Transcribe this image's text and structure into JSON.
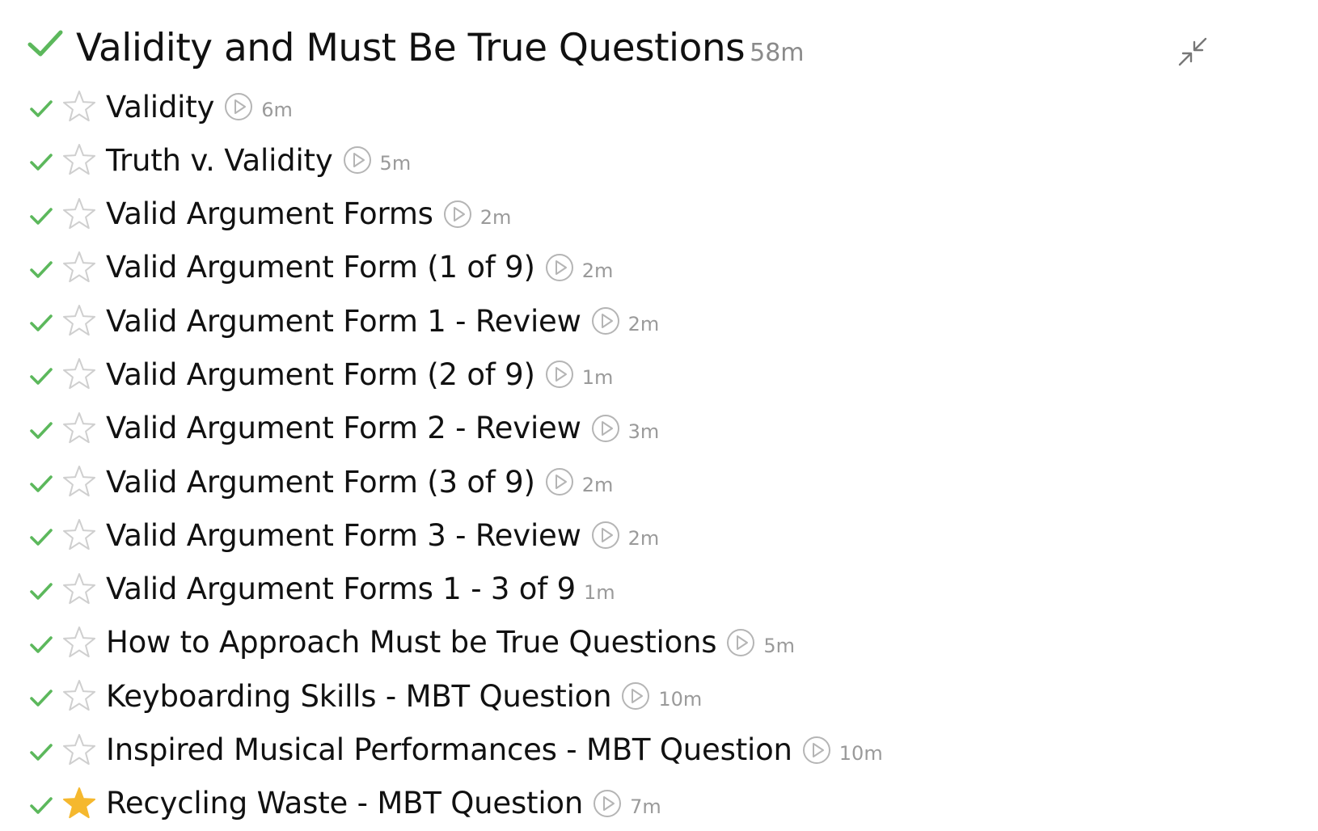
{
  "section": {
    "title": "Validity and Must Be True Questions",
    "duration": "58m",
    "completed": true,
    "icons": {
      "complete": "checkmark-icon",
      "collapse": "collapse-arrows-icon"
    },
    "colors": {
      "check": "#5cb85c",
      "star_filled": "#f5b82e",
      "star_outline": "#cfcfcf",
      "play_outline": "#b5b5b5",
      "muted_text": "#9a9a9a"
    }
  },
  "lessons": [
    {
      "title": "Validity",
      "duration": "6m",
      "has_video": true,
      "starred": false,
      "completed": true
    },
    {
      "title": "Truth v. Validity",
      "duration": "5m",
      "has_video": true,
      "starred": false,
      "completed": true
    },
    {
      "title": "Valid Argument Forms",
      "duration": "2m",
      "has_video": true,
      "starred": false,
      "completed": true
    },
    {
      "title": "Valid Argument Form (1 of 9)",
      "duration": "2m",
      "has_video": true,
      "starred": false,
      "completed": true
    },
    {
      "title": "Valid Argument Form 1 - Review",
      "duration": "2m",
      "has_video": true,
      "starred": false,
      "completed": true
    },
    {
      "title": "Valid Argument Form (2 of 9)",
      "duration": "1m",
      "has_video": true,
      "starred": false,
      "completed": true
    },
    {
      "title": "Valid Argument Form 2 - Review",
      "duration": "3m",
      "has_video": true,
      "starred": false,
      "completed": true
    },
    {
      "title": "Valid Argument Form (3 of 9)",
      "duration": "2m",
      "has_video": true,
      "starred": false,
      "completed": true
    },
    {
      "title": "Valid Argument Form 3 - Review",
      "duration": "2m",
      "has_video": true,
      "starred": false,
      "completed": true
    },
    {
      "title": "Valid Argument Forms 1 - 3 of 9",
      "duration": "1m",
      "has_video": false,
      "starred": false,
      "completed": true
    },
    {
      "title": "How to Approach Must be True Questions",
      "duration": "5m",
      "has_video": true,
      "starred": false,
      "completed": true
    },
    {
      "title": "Keyboarding Skills - MBT Question",
      "duration": "10m",
      "has_video": true,
      "starred": false,
      "completed": true
    },
    {
      "title": "Inspired Musical Performances - MBT Question",
      "duration": "10m",
      "has_video": true,
      "starred": false,
      "completed": true
    },
    {
      "title": "Recycling Waste - MBT Question",
      "duration": "7m",
      "has_video": true,
      "starred": true,
      "completed": true
    }
  ]
}
